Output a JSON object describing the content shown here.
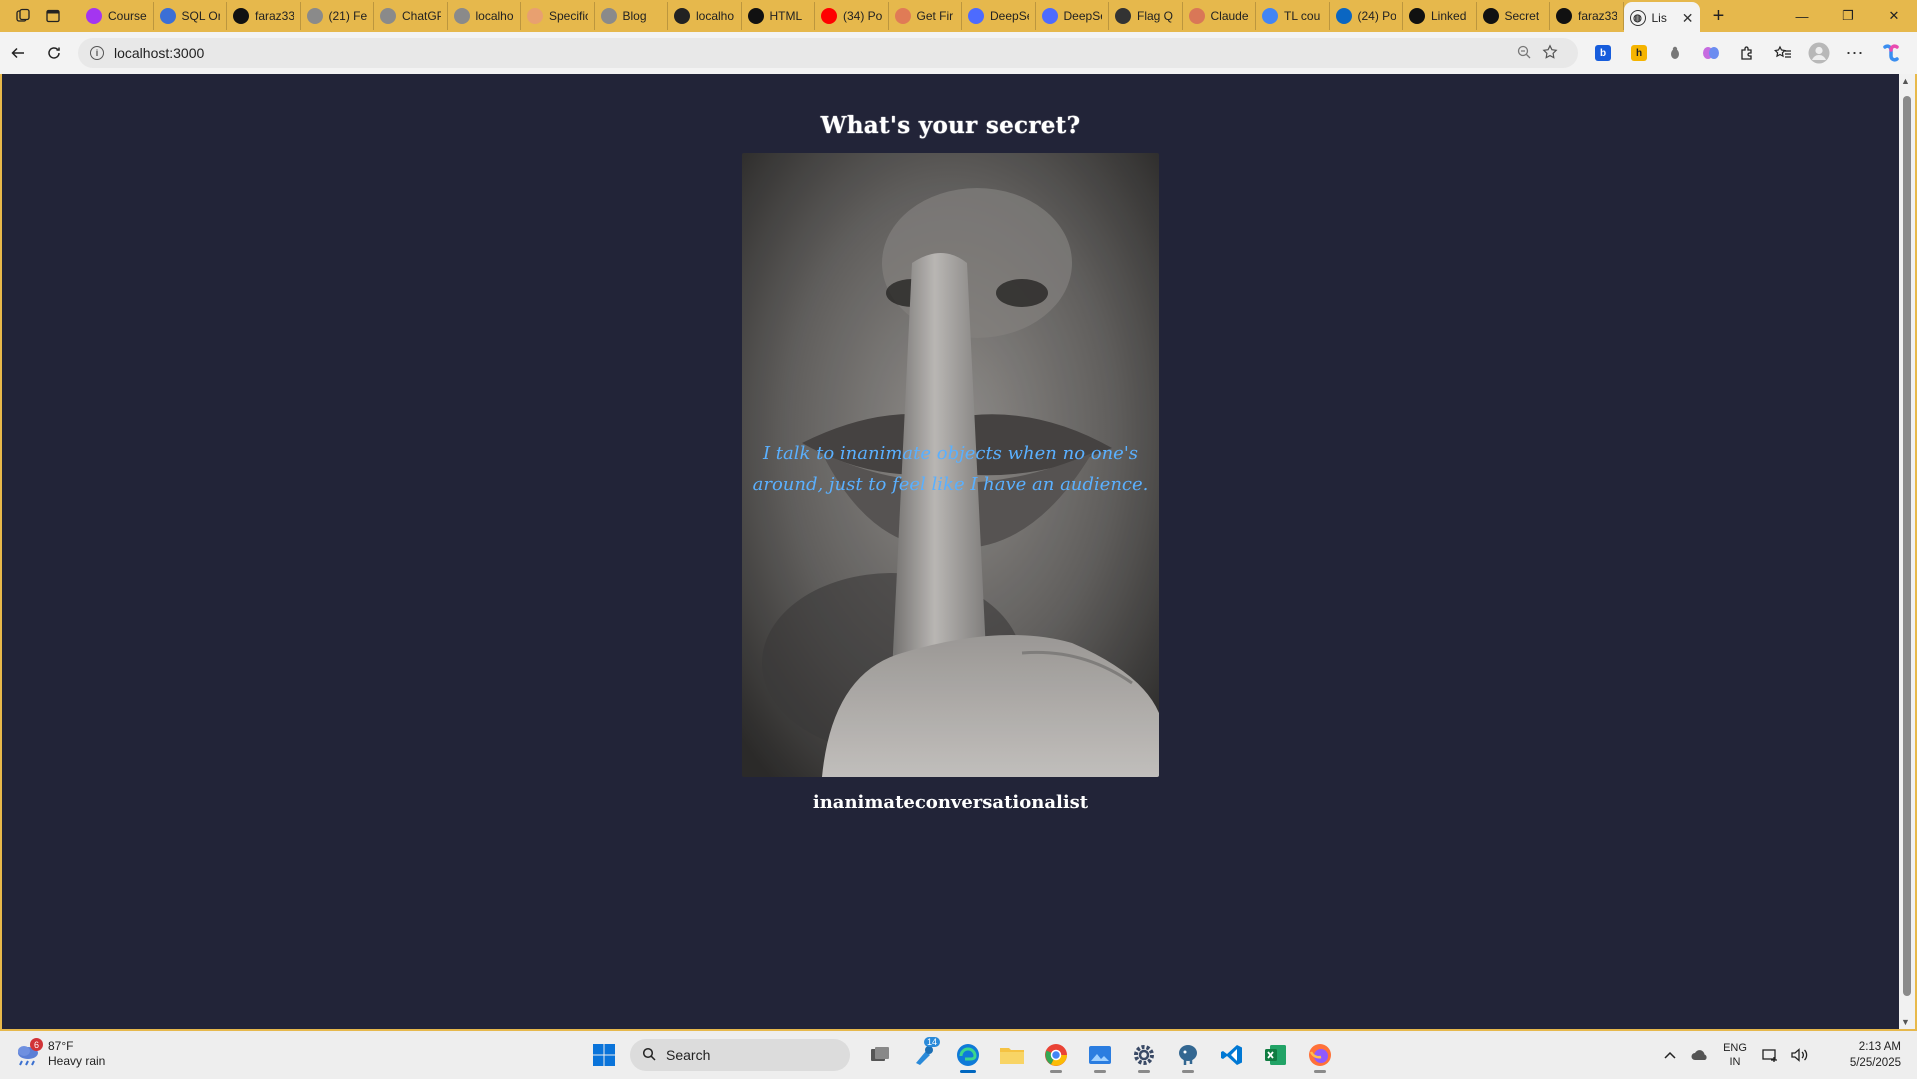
{
  "browser": {
    "tabs": [
      {
        "label": "Course",
        "favicon": "udemy",
        "color": "#a435f0"
      },
      {
        "label": "SQL Or",
        "favicon": "oracle-cloud",
        "color": "#3b6fd6"
      },
      {
        "label": "faraz33",
        "favicon": "github",
        "color": "#111111"
      },
      {
        "label": "(21) Fe",
        "favicon": "linkedin",
        "color": "#8a8a8a"
      },
      {
        "label": "ChatGP",
        "favicon": "globe",
        "color": "#8a8a8a"
      },
      {
        "label": "localho",
        "favicon": "lock-doc",
        "color": "#8a8a8a"
      },
      {
        "label": "Specific",
        "favicon": "claude",
        "color": "#e8a070"
      },
      {
        "label": "Blog",
        "favicon": "globe",
        "color": "#8a8a8a"
      },
      {
        "label": "localho",
        "favicon": "lock-doc",
        "color": "#222222"
      },
      {
        "label": "HTML",
        "favicon": "threads",
        "color": "#111111"
      },
      {
        "label": "(34) Po",
        "favicon": "youtube",
        "color": "#ff0000"
      },
      {
        "label": "Get Fir",
        "favicon": "claude",
        "color": "#e07b56"
      },
      {
        "label": "DeepSe",
        "favicon": "deepseek",
        "color": "#4d6bfe"
      },
      {
        "label": "DeepSe",
        "favicon": "deepseek",
        "color": "#4d6bfe"
      },
      {
        "label": "Flag Q",
        "favicon": "globe",
        "color": "#333333"
      },
      {
        "label": "Claude",
        "favicon": "claude",
        "color": "#d97757"
      },
      {
        "label": "TL cou",
        "favicon": "google",
        "color": "#4285f4"
      },
      {
        "label": "(24) Po",
        "favicon": "linkedin",
        "color": "#0a66c2"
      },
      {
        "label": "Linked",
        "favicon": "threads",
        "color": "#111111"
      },
      {
        "label": "Secret",
        "favicon": "github",
        "color": "#111111"
      },
      {
        "label": "faraz33",
        "favicon": "github",
        "color": "#111111"
      }
    ],
    "active_tab": {
      "label": "Lis",
      "close": "✕"
    },
    "new_tab": "+",
    "address": {
      "url": "localhost:3000"
    },
    "window_controls": {
      "minimize": "—",
      "restore": "❐",
      "close": "✕"
    }
  },
  "page": {
    "title": "What's your secret?",
    "secret_text": "I talk to inanimate objects when no one's around, just to feel like I have an audience.",
    "username": "inanimateconversationalist",
    "colors": {
      "background": "#222438",
      "secret_text": "#5ab0ff",
      "title": "#ffffff"
    }
  },
  "taskbar": {
    "weather": {
      "temp": "87°F",
      "condition": "Heavy rain",
      "badge": "6"
    },
    "search_placeholder": "Search",
    "language": {
      "line1": "ENG",
      "line2": "IN"
    },
    "time": "2:13 AM",
    "date": "5/25/2025",
    "steam_badge": "14"
  }
}
